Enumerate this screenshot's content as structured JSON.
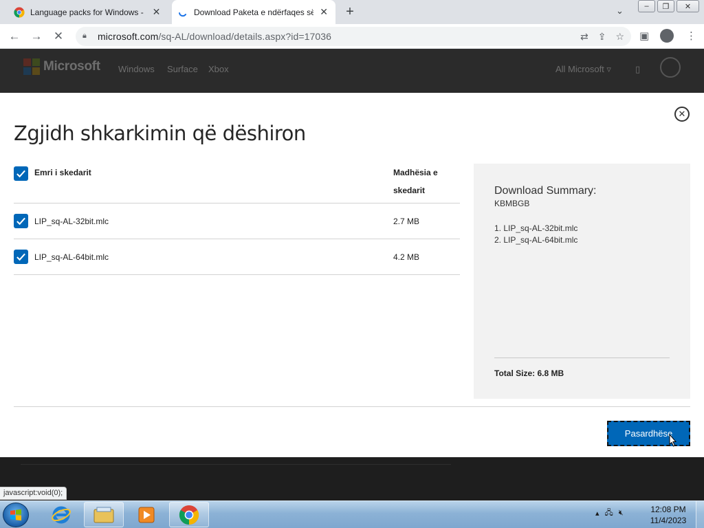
{
  "browser": {
    "tabs": [
      {
        "title": "Language packs for Windows - M",
        "active": false
      },
      {
        "title": "Download Paketa e ndërfaqes së",
        "active": true
      }
    ],
    "new_tab": "+",
    "url_host": "microsoft.com",
    "url_path": "/sq-AL/download/details.aspx?id=17036",
    "status_text": "javascript:void(0);"
  },
  "site": {
    "logo_text": "Microsoft",
    "nav": [
      "Windows",
      "Surface",
      "Xbox"
    ],
    "all_microsoft": "All Microsoft",
    "colors": {
      "red": "#5a2a22",
      "green": "#3d4a1e",
      "blue": "#1e3a52",
      "yellow": "#5a4a1a"
    }
  },
  "modal": {
    "title": "Zgjidh shkarkimin që dëshiron",
    "header_name": "Emri i skedarit",
    "header_size_line1": "Madhësia e",
    "header_size_line2": "skedarit",
    "files": [
      {
        "name": "LIP_sq-AL-32bit.mlc",
        "size": "2.7 MB",
        "checked": true
      },
      {
        "name": "LIP_sq-AL-64bit.mlc",
        "size": "4.2 MB",
        "checked": true
      }
    ],
    "summary": {
      "title": "Download Summary:",
      "subtitle": "KBMBGB",
      "items": [
        "1. LIP_sq-AL-32bit.mlc",
        "2. LIP_sq-AL-64bit.mlc"
      ],
      "total_label": "Total Size:",
      "total_value": "6.8 MB"
    },
    "next_button": "Pasardhëse",
    "accent": "#0067b8"
  },
  "taskbar": {
    "time": "12:08 PM",
    "date": "11/4/2023"
  }
}
